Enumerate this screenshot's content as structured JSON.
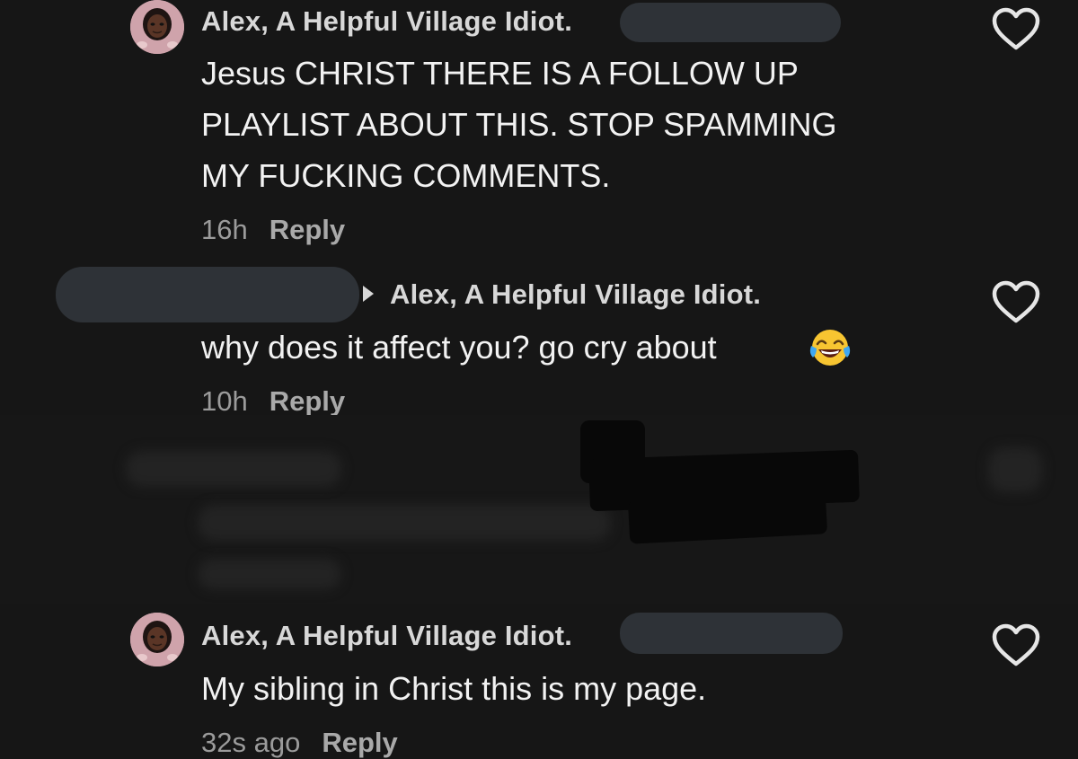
{
  "comments": [
    {
      "username": "Alex, A Helpful Village Idiot.",
      "lines": [
        "Jesus CHRIST THERE IS A FOLLOW UP",
        "PLAYLIST ABOUT THIS. STOP SPAMMING",
        "MY FUCKING COMMENTS."
      ],
      "time": "16h",
      "reply_label": "Reply"
    },
    {
      "reply_to": "Alex, A Helpful Village Idiot.",
      "text": "why does it affect you? go cry about",
      "emoji": "face-with-tears-of-joy",
      "time": "10h",
      "reply_label": "Reply"
    },
    {
      "username": "Alex, A Helpful Village Idiot.",
      "text": "My sibling in Christ this is my page.",
      "time": "32s ago",
      "reply_label": "Reply"
    }
  ],
  "icons": {
    "like": "heart-outline-icon",
    "reply_arrow": "caret-right-icon"
  },
  "colors": {
    "background": "#161616",
    "username": "#d8d8d8",
    "body_text": "#f2f2f2",
    "time": "#9b9b9b",
    "reply": "#a9a9a9",
    "redaction": "#2e3237"
  }
}
